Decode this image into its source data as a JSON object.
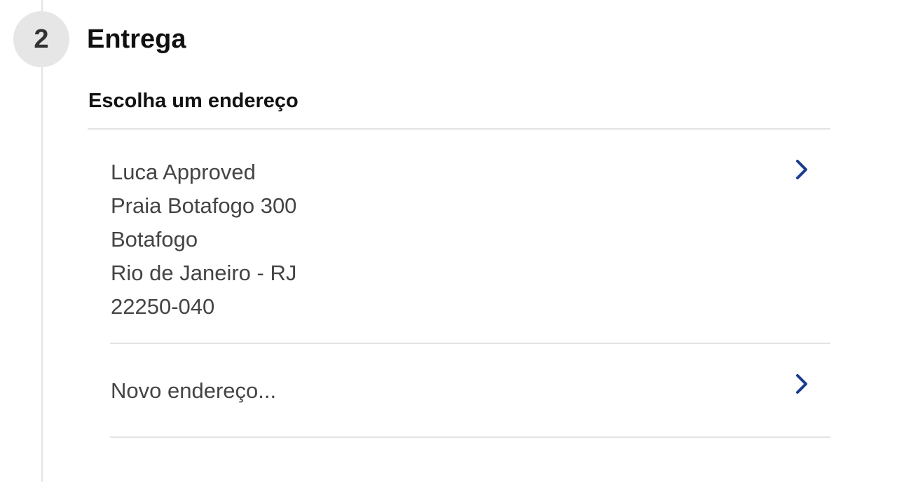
{
  "step": {
    "number": "2",
    "title": "Entrega"
  },
  "section": {
    "title": "Escolha um endereço"
  },
  "addresses": [
    {
      "lines": [
        "Luca Approved",
        "Praia Botafogo 300",
        "Botafogo",
        "Rio de Janeiro - RJ",
        "22250-040"
      ]
    }
  ],
  "new_address": {
    "label": "Novo endereço..."
  },
  "icons": {
    "select_address": "chevron-right-icon",
    "add_address": "chevron-right-icon"
  },
  "colors": {
    "accent": "#1a3d8f",
    "text": "#444444",
    "heading": "#111111",
    "step_circle_bg": "#e6e6e6",
    "divider": "#e3e3e3"
  }
}
